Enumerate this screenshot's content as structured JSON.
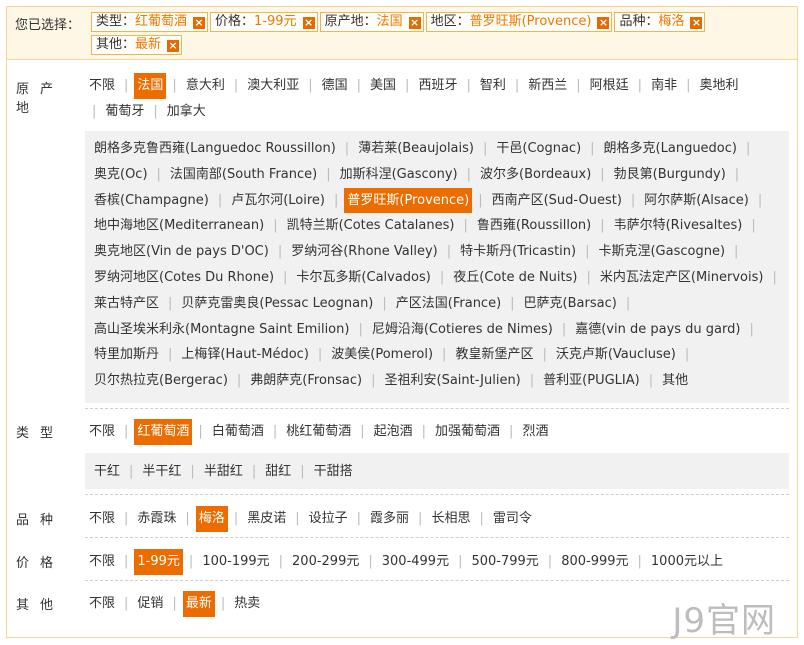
{
  "selected": {
    "label": "您已选择：",
    "chips": [
      {
        "k": "类型：",
        "v": "红葡萄酒",
        "x": "×"
      },
      {
        "k": "价格：",
        "v": "1-99元",
        "x": "×"
      },
      {
        "k": "原产地：",
        "v": "法国",
        "x": "×"
      },
      {
        "k": "地区：",
        "v": "普罗旺斯(Provence)",
        "x": "×"
      },
      {
        "k": "品种：",
        "v": "梅洛",
        "x": "×"
      },
      {
        "k": "其他：",
        "v": "最新",
        "x": "×"
      }
    ]
  },
  "origin": {
    "label": "原产地",
    "options": [
      "不限",
      "法国",
      "意大利",
      "澳大利亚",
      "德国",
      "美国",
      "西班牙",
      "智利",
      "新西兰",
      "阿根廷",
      "南非",
      "奥地利",
      "葡萄牙",
      "加拿大"
    ],
    "active": 1,
    "regions": [
      "朗格多克鲁西雍(Languedoc Roussillon)",
      "薄若莱(Beaujolais)",
      "干邑(Cognac)",
      "朗格多克(Languedoc)",
      "奥克(Oc)",
      "法国南部(South France)",
      "加斯科涅(Gascony)",
      "波尔多(Bordeaux)",
      "勃艮第(Burgundy)",
      "香槟(Champagne)",
      "卢瓦尔河(Loire)",
      "普罗旺斯(Provence)",
      "西南产区(Sud-Ouest)",
      "阿尔萨斯(Alsace)",
      "地中海地区(Mediterranean)",
      "凯特兰斯(Cotes Catalanes)",
      "鲁西雍(Roussillon)",
      "韦萨尔特(Rivesaltes)",
      "奥克地区(Vin de pays D'OC)",
      "罗纳河谷(Rhone Valley)",
      "特卡斯丹(Tricastin)",
      "卡斯克涅(Gascogne)",
      "罗纳河地区(Cotes Du Rhone)",
      "卡尔瓦多斯(Calvados)",
      "夜丘(Cote de Nuits)",
      "米内瓦法定产区(Minervois)",
      "莱古特产区",
      "贝萨克雷奥良(Pessac Leognan)",
      "产区法国(France)",
      "巴萨克(Barsac)",
      "高山圣埃米利永(Montagne Saint Emilion)",
      "尼姆沿海(Cotieres de Nimes)",
      "嘉德(vin de pays du gard)",
      "特里加斯丹",
      "上梅铎(Haut-Médoc)",
      "波美侯(Pomerol)",
      "教皇新堡产区",
      "沃克卢斯(Vaucluse)",
      "贝尔热拉克(Bergerac)",
      "弗朗萨克(Fronsac)",
      "圣祖利安(Saint-Julien)",
      "普利亚(PUGLIA)",
      "其他"
    ],
    "region_active": 11
  },
  "type": {
    "label": "类型",
    "options": [
      "不限",
      "红葡萄酒",
      "白葡萄酒",
      "桃红葡萄酒",
      "起泡酒",
      "加强葡萄酒",
      "烈酒"
    ],
    "active": 1,
    "sub": [
      "干红",
      "半干红",
      "半甜红",
      "甜红",
      "干甜搭"
    ]
  },
  "variety": {
    "label": "品种",
    "options": [
      "不限",
      "赤霞珠",
      "梅洛",
      "黑皮诺",
      "设拉子",
      "霞多丽",
      "长相思",
      "雷司令"
    ],
    "active": 2
  },
  "price": {
    "label": "价格",
    "options": [
      "不限",
      "1-99元",
      "100-199元",
      "200-299元",
      "300-499元",
      "500-799元",
      "800-999元",
      "1000元以上"
    ],
    "active": 1
  },
  "other": {
    "label": "其他",
    "options": [
      "不限",
      "促销",
      "最新",
      "热卖"
    ],
    "active": 2
  },
  "watermark": "J9官网"
}
